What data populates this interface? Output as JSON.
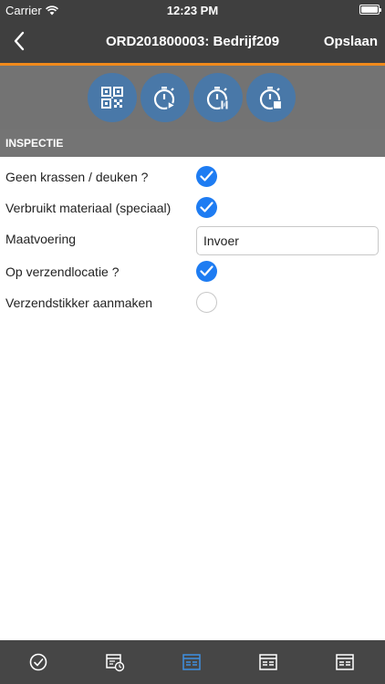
{
  "status_bar": {
    "carrier": "Carrier",
    "time": "12:23 PM"
  },
  "nav": {
    "title": "ORD201800003: Bedrijf209",
    "save_label": "Opslaan"
  },
  "toolbar": {
    "icons": [
      "qr-code-icon",
      "timer-play-icon",
      "timer-pause-icon",
      "timer-stop-icon"
    ]
  },
  "section": {
    "title": "INSPECTIE"
  },
  "fields": [
    {
      "label": "Geen krassen / deuken ?",
      "type": "checkbox",
      "checked": true
    },
    {
      "label": "Verbruikt materiaal (speciaal)",
      "type": "checkbox",
      "checked": true
    },
    {
      "label": "Maatvoering",
      "type": "text",
      "value": "Invoer"
    },
    {
      "label": "Op verzendlocatie ?",
      "type": "checkbox",
      "checked": true
    },
    {
      "label": "Verzendstikker aanmaken",
      "type": "checkbox",
      "checked": false
    }
  ],
  "tabs": [
    "check-circle-icon",
    "schedule-form-icon",
    "form-icon",
    "form-icon",
    "form-icon"
  ],
  "colors": {
    "bar": "#3f3f3f",
    "accent": "#f08a1c",
    "toolbar": "#737373",
    "tool_button": "#4978a8",
    "checkbox_on": "#1e7cf2",
    "tab_active": "#3f8fe0",
    "tab_inactive": "#ffffff"
  }
}
